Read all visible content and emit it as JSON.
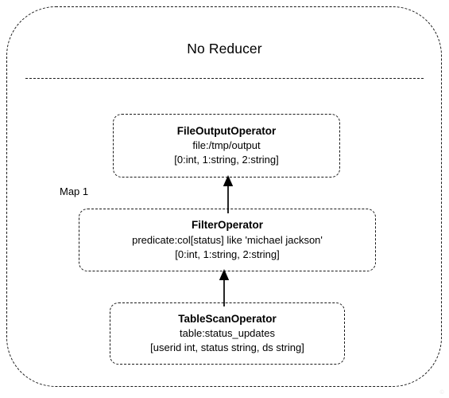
{
  "diagram": {
    "type": "query-execution-plan",
    "stage": {
      "title": "No Reducer",
      "sub_stage_label": "Map 1"
    },
    "operators": [
      {
        "id": "fileoutput",
        "name": "FileOutputOperator",
        "detail": "file:/tmp/output",
        "schema": "[0:int, 1:string, 2:string]"
      },
      {
        "id": "filter",
        "name": "FilterOperator",
        "detail": "predicate:col[status] like 'michael jackson'",
        "schema": "[0:int, 1:string, 2:string]"
      },
      {
        "id": "tablescan",
        "name": "TableScanOperator",
        "detail": "table:status_updates",
        "schema": "[userid int, status string, ds string]"
      }
    ],
    "edges": [
      {
        "id": "edge-tablescan-to-filter",
        "from": "tablescan",
        "to": "filter",
        "direction": "up"
      },
      {
        "id": "edge-filter-to-fileoutput",
        "from": "filter",
        "to": "fileoutput",
        "direction": "up"
      }
    ],
    "colors": {
      "stroke": "#1a1a1a",
      "text": "#000000",
      "background": "#ffffff",
      "watermark": "#e8e8e8"
    },
    "watermark": "©"
  }
}
